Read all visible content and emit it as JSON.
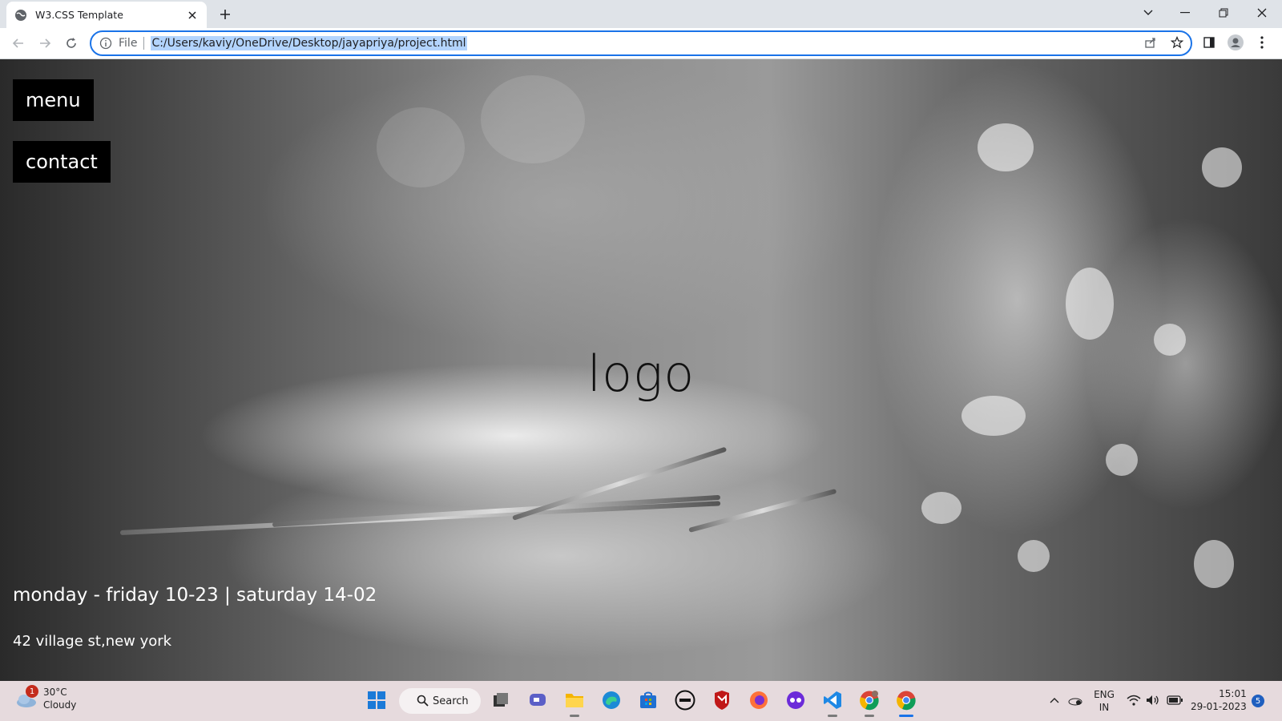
{
  "browser": {
    "tab_title": "W3.CSS Template",
    "scheme_label": "File",
    "url": "C:/Users/kaviy/OneDrive/Desktop/jayapriya/project.html"
  },
  "page": {
    "menu_label": "menu",
    "contact_label": "contact",
    "logo_text": "logo",
    "hours": "monday - friday 10-23 | saturday 14-02",
    "address": "42 village st,new york"
  },
  "taskbar": {
    "weather_badge": "1",
    "temperature": "30°C",
    "condition": "Cloudy",
    "search_label": "Search",
    "language": "ENG",
    "region": "IN",
    "time": "15:01",
    "date": "29-01-2023",
    "notification_count": "5"
  },
  "colors": {
    "omnibox_focus": "#1a73e8",
    "url_selection": "#b3d4fd",
    "page_button_bg": "#000000",
    "taskbar_bg": "#e6dadd"
  }
}
